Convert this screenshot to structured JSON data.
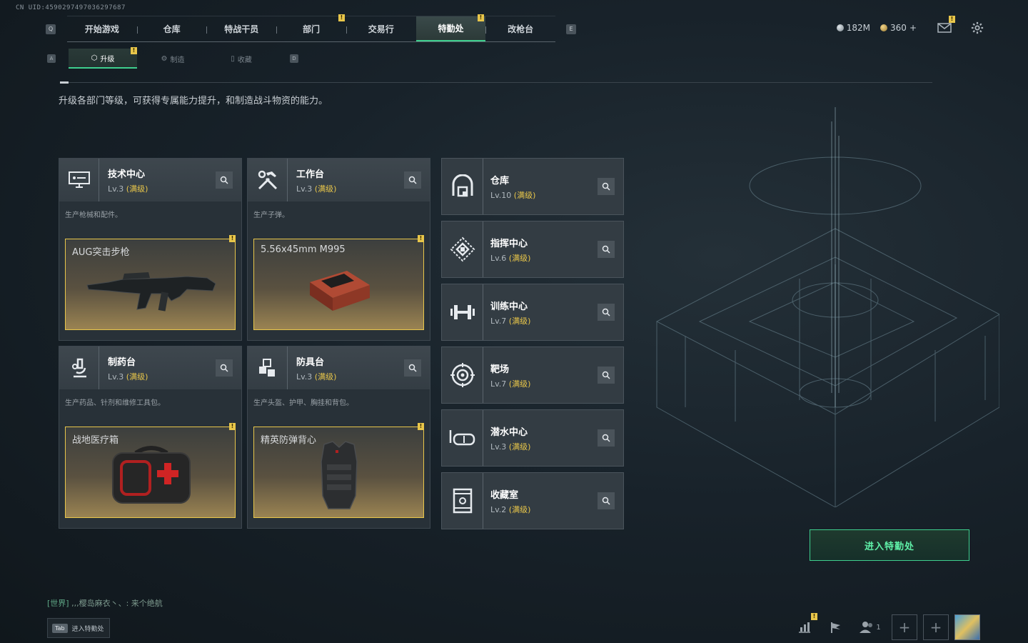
{
  "uid": "CN UID:4590297497036297687",
  "top_nav": {
    "key_left": "Q",
    "key_right": "E",
    "tabs": [
      {
        "label": "开始游戏"
      },
      {
        "label": "仓库"
      },
      {
        "label": "特战干员"
      },
      {
        "label": "部门"
      },
      {
        "label": "交易行"
      },
      {
        "label": "特勤处"
      },
      {
        "label": "改枪台"
      }
    ],
    "active_tab": "特勤处"
  },
  "sub_nav": {
    "key_left": "A",
    "key_right": "D",
    "tabs": [
      {
        "label": "升级"
      },
      {
        "label": "制造"
      },
      {
        "label": "收藏"
      }
    ],
    "active_tab": "升级"
  },
  "hud": {
    "silver": "182M",
    "gold": "360",
    "gold_plus": "+"
  },
  "description": "升级各部门等级，可获得专属能力提升，和制造战斗物资的能力。",
  "production_cards": [
    {
      "name": "技术中心",
      "lv": "Lv.3",
      "max": "(满级)",
      "sub": "生产枪械和配件。",
      "product": "AUG突击步枪",
      "icon": "monitor-icon"
    },
    {
      "name": "工作台",
      "lv": "Lv.3",
      "max": "(满级)",
      "sub": "生产子弹。",
      "product": "5.56x45mm M995",
      "icon": "tools-icon"
    },
    {
      "name": "制药台",
      "lv": "Lv.3",
      "max": "(满级)",
      "sub": "生产药品、针剂和维修工具包。",
      "product": "战地医疗箱",
      "icon": "microscope-icon"
    },
    {
      "name": "防具台",
      "lv": "Lv.3",
      "max": "(满级)",
      "sub": "生产头盔、护甲、胸挂和背包。",
      "product": "精英防弹背心",
      "icon": "cubes-icon"
    }
  ],
  "buildings": [
    {
      "name": "仓库",
      "lv": "Lv.10",
      "max": "(满级)",
      "icon": "warehouse-icon"
    },
    {
      "name": "指挥中心",
      "lv": "Lv.6",
      "max": "(满级)",
      "icon": "command-icon"
    },
    {
      "name": "训练中心",
      "lv": "Lv.7",
      "max": "(满级)",
      "icon": "dumbbell-icon"
    },
    {
      "name": "靶场",
      "lv": "Lv.7",
      "max": "(满级)",
      "icon": "target-icon"
    },
    {
      "name": "潜水中心",
      "lv": "Lv.3",
      "max": "(满级)",
      "icon": "diving-mask-icon"
    },
    {
      "name": "收藏室",
      "lv": "Lv.2",
      "max": "(满级)",
      "icon": "trophy-case-icon"
    }
  ],
  "enter_button": "进入特勤处",
  "chat": {
    "channel": "[世界]",
    "text": ",,,樱岛麻衣丶、: 来个绝航"
  },
  "tab_hint": {
    "key": "Tab",
    "label": "进入特勤处"
  },
  "bottom_bar": {
    "team_count": "1"
  },
  "flag_mark": "!"
}
